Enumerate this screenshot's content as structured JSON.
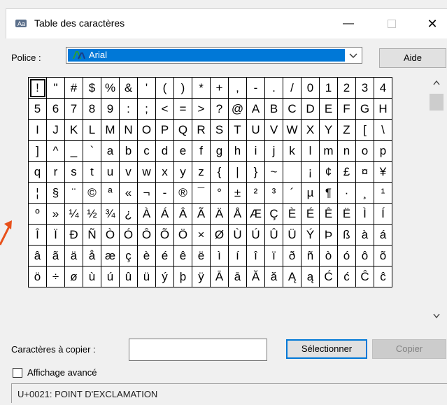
{
  "window": {
    "title": "Table des caractères",
    "minimize_glyph": "—",
    "close_glyph": "✕"
  },
  "font": {
    "label": "Police :",
    "selected": "Arial",
    "help_button": "Aide"
  },
  "grid": {
    "rows": [
      [
        "!",
        "\"",
        "#",
        "$",
        "%",
        "&",
        "'",
        "(",
        ")",
        "*",
        "+",
        ",",
        "-",
        ".",
        "/",
        "0",
        "1",
        "2",
        "3",
        "4"
      ],
      [
        "5",
        "6",
        "7",
        "8",
        "9",
        ":",
        ";",
        "<",
        "=",
        ">",
        "?",
        "@",
        "A",
        "B",
        "C",
        "D",
        "E",
        "F",
        "G",
        "H"
      ],
      [
        "I",
        "J",
        "K",
        "L",
        "M",
        "N",
        "O",
        "P",
        "Q",
        "R",
        "S",
        "T",
        "U",
        "V",
        "W",
        "X",
        "Y",
        "Z",
        "[",
        "\\"
      ],
      [
        "]",
        "^",
        "_",
        "`",
        "a",
        "b",
        "c",
        "d",
        "e",
        "f",
        "g",
        "h",
        "i",
        "j",
        "k",
        "l",
        "m",
        "n",
        "o",
        "p"
      ],
      [
        "q",
        "r",
        "s",
        "t",
        "u",
        "v",
        "w",
        "x",
        "y",
        "z",
        "{",
        "|",
        "}",
        "~",
        " ",
        "¡",
        "¢",
        "£",
        "¤",
        "¥"
      ],
      [
        "¦",
        "§",
        "¨",
        "©",
        "ª",
        "«",
        "¬",
        "-",
        "®",
        "¯",
        "°",
        "±",
        "²",
        "³",
        "´",
        "µ",
        "¶",
        "·",
        "¸",
        "¹"
      ],
      [
        "º",
        "»",
        "¼",
        "½",
        "¾",
        "¿",
        "À",
        "Á",
        "Â",
        "Ã",
        "Ä",
        "Å",
        "Æ",
        "Ç",
        "È",
        "É",
        "Ê",
        "Ë",
        "Ì",
        "Í"
      ],
      [
        "Î",
        "Ï",
        "Ð",
        "Ñ",
        "Ò",
        "Ó",
        "Ô",
        "Õ",
        "Ö",
        "×",
        "Ø",
        "Ù",
        "Ú",
        "Û",
        "Ü",
        "Ý",
        "Þ",
        "ß",
        "à",
        "á"
      ],
      [
        "â",
        "ã",
        "ä",
        "å",
        "æ",
        "ç",
        "è",
        "é",
        "ê",
        "ë",
        "ì",
        "í",
        "î",
        "ï",
        "ð",
        "ñ",
        "ò",
        "ó",
        "ô",
        "õ"
      ],
      [
        "ö",
        "÷",
        "ø",
        "ù",
        "ú",
        "û",
        "ü",
        "ý",
        "þ",
        "ÿ",
        "Ā",
        "ā",
        "Ă",
        "ă",
        "Ą",
        "ą",
        "Ć",
        "ć",
        "Ĉ",
        "ĉ"
      ]
    ],
    "selected_char": "!"
  },
  "copy": {
    "label": "Caractères à copier :",
    "value": "",
    "select_button": "Sélectionner",
    "copy_button": "Copier"
  },
  "advanced_view": {
    "label": "Affichage avancé",
    "checked": false
  },
  "status": {
    "text": "U+0021: POINT D'EXCLAMATION"
  },
  "colors": {
    "selection_blue": "#0078d7",
    "annotation_arrow": "#e8501a"
  },
  "icons": {
    "app": "charmap-icon",
    "font": "opentype-font-icon",
    "dropdown": "chevron-down-icon",
    "scroll_up": "chevron-up-icon",
    "scroll_down": "chevron-down-icon",
    "annotation": "red-arrow-icon"
  }
}
